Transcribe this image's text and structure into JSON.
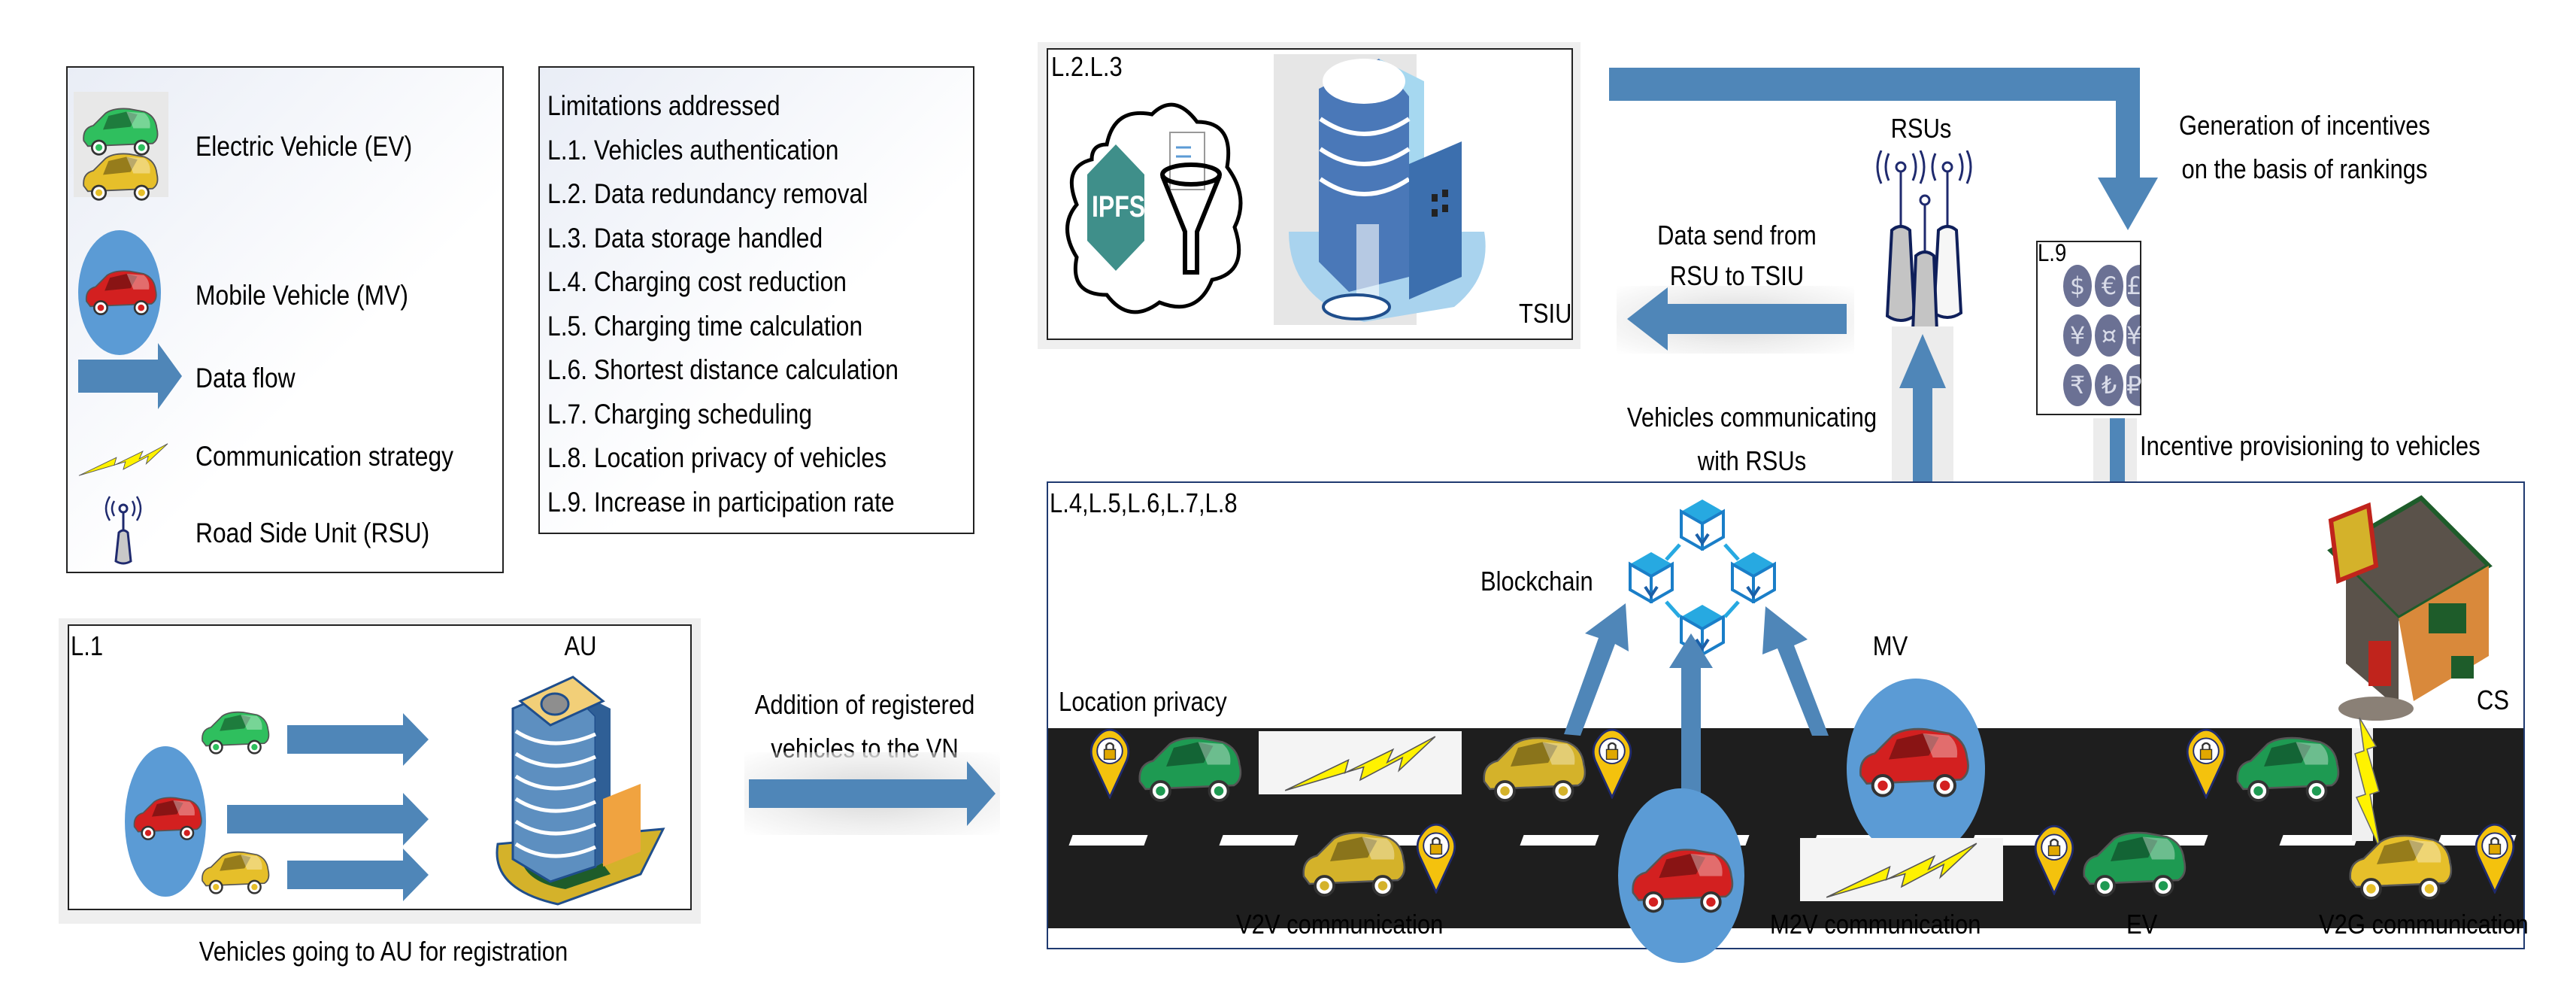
{
  "legend": {
    "items": [
      {
        "icon": "car-icon-ev",
        "label": "Electric Vehicle (EV)"
      },
      {
        "icon": "car-icon-mv",
        "label": "Mobile Vehicle (MV)"
      },
      {
        "icon": "arrow-right-icon",
        "label": "Data flow"
      },
      {
        "icon": "lightning-icon",
        "label": "Communication strategy"
      },
      {
        "icon": "antenna-icon",
        "label": "Road Side Unit (RSU)"
      }
    ]
  },
  "limitations": {
    "title": "Limitations addressed",
    "items": [
      "L.1.  Vehicles  authentication",
      "L.2.  Data redundancy removal",
      "L.3.  Data storage handled",
      "L.4.  Charging cost reduction",
      "L.5.  Charging time calculation",
      "L.6.  Shortest distance calculation",
      "L.7.  Charging scheduling",
      "L.8.  Location privacy of vehicles",
      "L.9.  Increase in participation rate"
    ]
  },
  "storage_panel": {
    "tag": "L.2.L.3",
    "ipfs_label": "IPFS",
    "building_label": "TSIU"
  },
  "rsu": {
    "label": "RSUs",
    "data_send_label_1": "Data send from",
    "data_send_label_2": "RSU to TSIU",
    "vehicles_comm_label_1": "Vehicles communicating",
    "vehicles_comm_label_2": "with RSUs"
  },
  "incentives": {
    "generation_label_1": "Generation of incentives",
    "generation_label_2": "on the basis of rankings",
    "tag": "L.9",
    "currency_symbols": [
      "$",
      "€",
      "£",
      "¥",
      "¤",
      "¥",
      "₹",
      "₺",
      "₽"
    ],
    "provisioning_label": "Incentive provisioning to vehicles"
  },
  "registration_panel": {
    "tag": "L.1",
    "authority_label": "AU",
    "caption": "Vehicles going to AU for registration",
    "addition_label_1": "Addition of registered",
    "addition_label_2": "vehicles to the VN"
  },
  "road_panel": {
    "tag": "L.4,L.5,L.6,L.7,L.8",
    "blockchain_label": "Blockchain",
    "location_privacy_label": "Location privacy",
    "mv_label": "MV",
    "ev_label": "EV",
    "cs_label": "CS",
    "v2v_label": "V2V communication",
    "m2v_label": "M2V communication",
    "v2g_label": "V2G communication"
  },
  "colors": {
    "arrow": "#4f86b8",
    "mv_circle": "#5b9bd5",
    "ev_green": "#1e9a52",
    "car_yellow": "#d4b22a",
    "mv_red": "#d32020",
    "road": "#1e1e1e",
    "lightning": "#fff200",
    "ipfs": "#3f8f8a",
    "coin": "#6b7194"
  }
}
